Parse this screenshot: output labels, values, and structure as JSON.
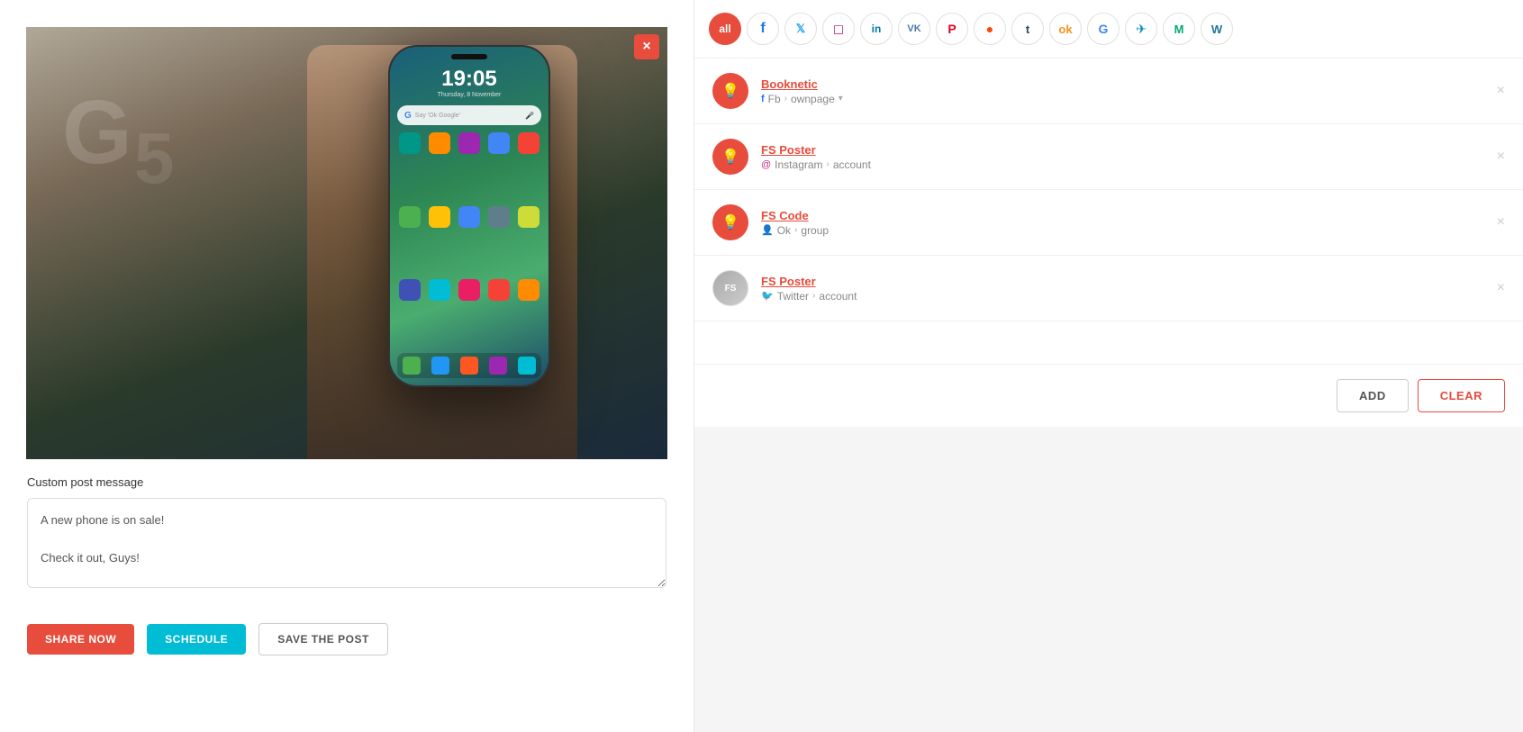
{
  "left_panel": {
    "close_button_label": "×",
    "post_message_label": "Custom post message",
    "post_message_text": "A new phone is on sale!\n\nCheck it out, Guys!",
    "post_message_placeholder": "A new phone is on sale!\n\nCheck it out, Guys!",
    "buttons": {
      "share_now": "SHARE NOW",
      "schedule": "SCHEDULE",
      "save_the_post": "SAVE THE POST"
    }
  },
  "right_panel": {
    "tabs": [
      {
        "id": "all",
        "label": "all",
        "active": true,
        "icon": ""
      },
      {
        "id": "facebook",
        "label": "",
        "icon": "f",
        "class": "facebook"
      },
      {
        "id": "twitter",
        "label": "",
        "icon": "t",
        "class": "twitter"
      },
      {
        "id": "instagram",
        "label": "",
        "icon": "◻",
        "class": "instagram"
      },
      {
        "id": "linkedin",
        "label": "",
        "icon": "in",
        "class": "linkedin"
      },
      {
        "id": "vk",
        "label": "",
        "icon": "vk",
        "class": "vk"
      },
      {
        "id": "pinterest",
        "label": "",
        "icon": "p",
        "class": "pinterest"
      },
      {
        "id": "reddit",
        "label": "",
        "icon": "r",
        "class": "reddit"
      },
      {
        "id": "tumblr",
        "label": "",
        "icon": "t",
        "class": "tumblr"
      },
      {
        "id": "ok",
        "label": "",
        "icon": "ok",
        "class": "ok"
      },
      {
        "id": "google",
        "label": "",
        "icon": "G",
        "class": "google"
      },
      {
        "id": "telegram",
        "label": "",
        "icon": "✈",
        "class": "telegram"
      },
      {
        "id": "medium",
        "label": "",
        "icon": "M",
        "class": "medium"
      },
      {
        "id": "wordpress",
        "label": "",
        "icon": "W",
        "class": "wordpress"
      }
    ],
    "accounts": [
      {
        "id": 1,
        "name": "Booknetic",
        "network": "Fb",
        "type": "ownpage",
        "path": "Fb > ownpage",
        "avatar_color": "#e74c3c",
        "avatar_icon": "💡",
        "filter_icon": "▾"
      },
      {
        "id": 2,
        "name": "FS Poster",
        "network": "Instagram",
        "type": "account",
        "path": "Instagram > account",
        "avatar_color": "#e74c3c",
        "avatar_icon": "💡"
      },
      {
        "id": 3,
        "name": "FS Code",
        "network": "Ok",
        "type": "group",
        "path": "Ok > group",
        "avatar_color": "#e74c3c",
        "avatar_icon": "💡"
      },
      {
        "id": 4,
        "name": "FS Poster",
        "network": "Twitter",
        "type": "account",
        "path": "Twitter > account",
        "avatar_color": "#aaa",
        "avatar_icon": "🐦",
        "is_twitter": true
      }
    ],
    "buttons": {
      "add": "ADD",
      "clear": "CLEAR"
    }
  },
  "phone": {
    "time": "19:05",
    "date": "Thursday, 8 November",
    "search_placeholder": "Say 'Ok Google'"
  }
}
